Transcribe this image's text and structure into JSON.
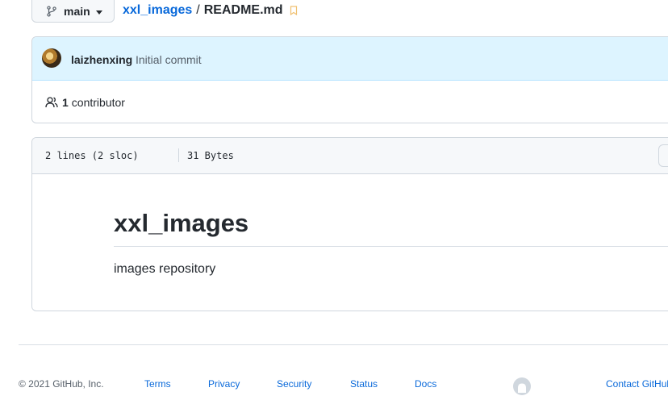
{
  "branch": {
    "label": "main"
  },
  "breadcrumb": {
    "repo": "xxl_images",
    "separator": "/",
    "file": "README.md"
  },
  "commit": {
    "author": "laizhenxing",
    "message": "Initial commit"
  },
  "contributors": {
    "count": "1",
    "label": "contributor"
  },
  "file_info": {
    "lines": "2 lines (2 sloc)",
    "size": "31 Bytes"
  },
  "readme": {
    "title": "xxl_images",
    "body": "images repository"
  },
  "footer": {
    "copyright": "© 2021 GitHub, Inc.",
    "links": [
      "Terms",
      "Privacy",
      "Security",
      "Status",
      "Docs"
    ],
    "contact": "Contact GitHub"
  },
  "colors": {
    "link": "#0969da",
    "commit_bg": "#ddf4ff",
    "header_bg": "#f6f8fa",
    "border": "#d0d7de"
  },
  "icons": [
    "git-branch-icon",
    "bookmark-icon",
    "people-icon",
    "github-logo-icon"
  ]
}
